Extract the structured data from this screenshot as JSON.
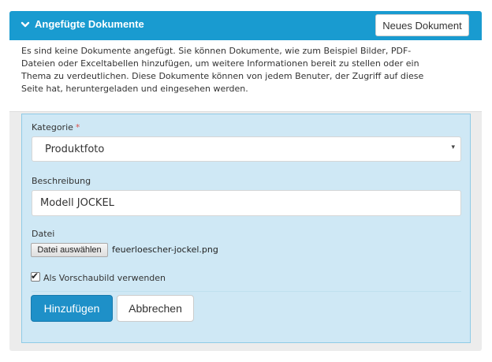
{
  "panel": {
    "title": "Angefügte Dokumente",
    "new_document_button": "Neues Dokument",
    "accent_color": "#199bd0",
    "toggle_icon": "chevron-down-icon"
  },
  "notice": {
    "text": "Es sind keine Dokumente angefügt. Sie können Dokumente, wie zum Beispiel Bilder, PDF-Dateien oder Exceltabellen hinzufügen, um weitere Informationen bereit zu stellen oder ein Thema zu verdeutlichen. Diese Dokumente können von jedem Benuter, der Zugriff auf diese Seite hat, heruntergeladen und eingesehen werden."
  },
  "form": {
    "category_label": "Kategorie",
    "required_marker": "*",
    "category_value": "Produktfoto",
    "category_caret": "▾",
    "description_label": "Beschreibung",
    "description_value": "Modell JOCKEL",
    "file_label": "Datei",
    "file_button": "Datei auswählen",
    "file_name": "feuerloescher-jockel.png",
    "thumbnail_checkbox_label": "Als Vorschaubild verwenden",
    "thumbnail_checked": true,
    "check_glyph": "✔",
    "add_button": "Hinzufügen",
    "cancel_button": "Abbrechen",
    "form_background": "#cfe8f5",
    "primary_button_color": "#1e90c8"
  }
}
